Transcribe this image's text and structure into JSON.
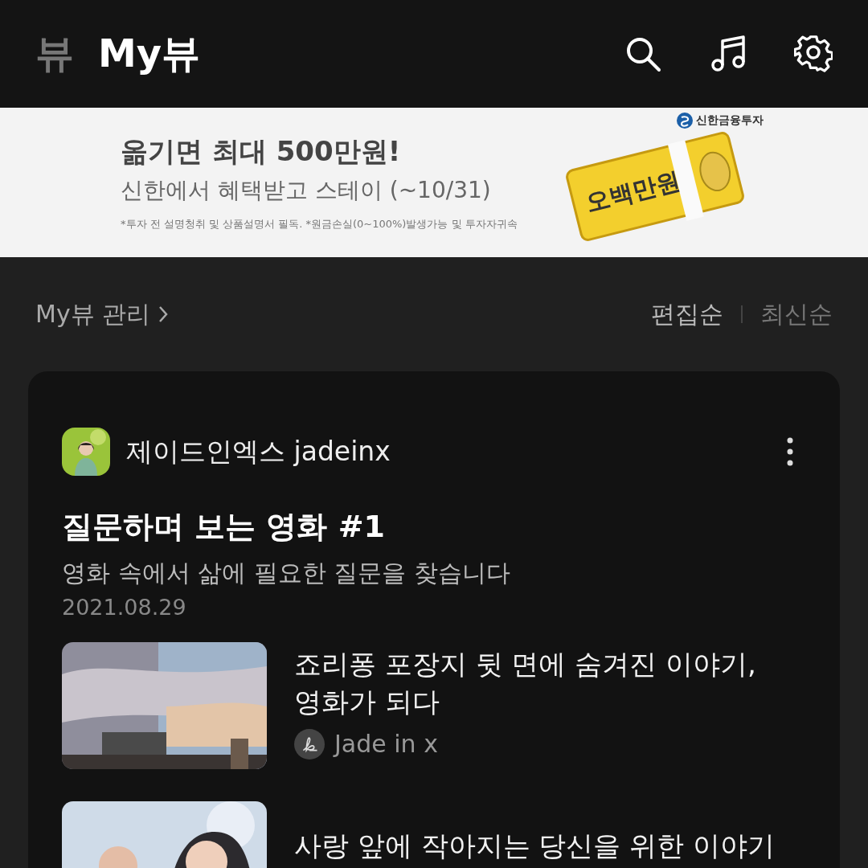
{
  "header": {
    "tabs": [
      {
        "label": "뷰",
        "selected": false
      },
      {
        "label": "My뷰",
        "selected": true
      }
    ]
  },
  "banner": {
    "headline": "옮기면 최대 500만원!",
    "subline": "신한에서 혜택받고 스테이 (~10/31)",
    "disclaimer": "*투자 전 설명청취 및 상품설명서 필독. *원금손실(0~100%)발생가능 및 투자자귀속",
    "brand": "신한금융투자",
    "bundle_text": "오백만원"
  },
  "toolbar": {
    "manage": "My뷰 관리",
    "sort": [
      {
        "label": "편집순",
        "selected": true
      },
      {
        "label": "최신순",
        "selected": false
      }
    ]
  },
  "card": {
    "channel": "제이드인엑스 jadeinx",
    "title": "질문하며 보는 영화 #1",
    "subtitle": "영화 속에서 삶에 필요한 질문을 찾습니다",
    "date": "2021.08.29",
    "articles": [
      {
        "title": "죠리퐁 포장지 뒷 면에 숨겨진 이야기,\n영화가 되다",
        "author": "Jade in x",
        "kind": "picture"
      },
      {
        "title": "사랑 앞에 작아지는 당신을 위한 이야기",
        "kind": "picture"
      }
    ]
  }
}
